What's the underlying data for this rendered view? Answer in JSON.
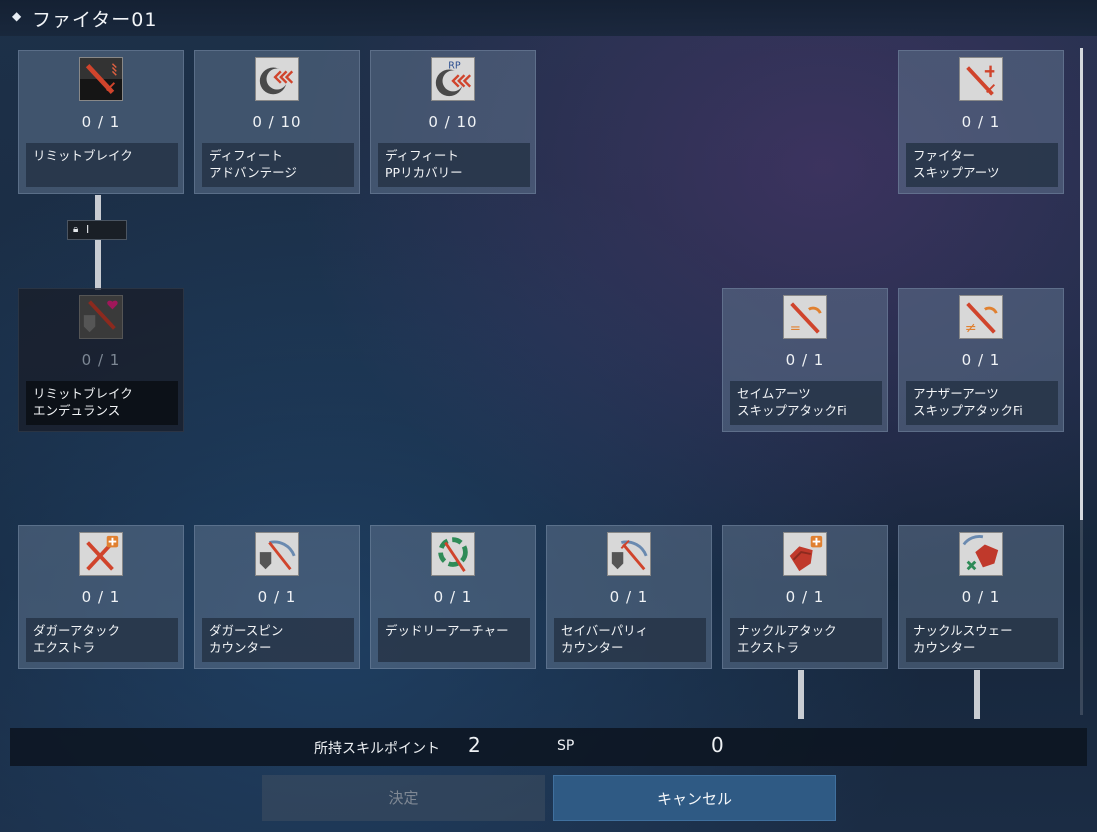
{
  "window": {
    "title": "ファイター01"
  },
  "skills": [
    {
      "id": "limit-break",
      "level": "0 / 1",
      "name": "リミットブレイク",
      "locked": false,
      "icon": "sword-icon"
    },
    {
      "id": "defeat-advantage",
      "level": "0 / 10",
      "name": "ディフィート\nアドバンテージ",
      "locked": false,
      "icon": "defeat-advantage-icon"
    },
    {
      "id": "defeat-pp-recovery",
      "level": "0 / 10",
      "name": "ディフィート\nPPリカバリー",
      "locked": false,
      "icon": "pp-recovery-icon",
      "icon_text": "RP"
    },
    {
      "id": "fighter-skip-arts",
      "level": "0 / 1",
      "name": "ファイター\nスキップアーツ",
      "locked": false,
      "icon": "skip-arts-icon"
    },
    {
      "id": "limit-break-endurance",
      "level": "0 / 1",
      "name": "リミットブレイク\nエンデュランス",
      "locked": true,
      "icon": "shield-sword-heart-icon"
    },
    {
      "id": "same-arts-skip",
      "level": "0 / 1",
      "name": "セイムアーツ\nスキップアタックFi",
      "locked": false,
      "icon": "same-arts-icon",
      "icon_text": "="
    },
    {
      "id": "another-arts-skip",
      "level": "0 / 1",
      "name": "アナザーアーツ\nスキップアタックFi",
      "locked": false,
      "icon": "another-arts-icon",
      "icon_text": "≠"
    },
    {
      "id": "dagger-attack-extra",
      "level": "0 / 1",
      "name": "ダガーアタック\nエクストラ",
      "locked": false,
      "icon": "dagger-extra-icon"
    },
    {
      "id": "dagger-spin-counter",
      "level": "0 / 1",
      "name": "ダガースピン\nカウンター",
      "locked": false,
      "icon": "dagger-counter-icon"
    },
    {
      "id": "deadly-archer",
      "level": "0 / 1",
      "name": "デッドリーアーチャー",
      "locked": false,
      "icon": "deadly-archer-icon"
    },
    {
      "id": "saber-parry-counter",
      "level": "0 / 1",
      "name": "セイバーパリィ\nカウンター",
      "locked": false,
      "icon": "saber-parry-icon"
    },
    {
      "id": "knuckle-attack-extra",
      "level": "0 / 1",
      "name": "ナックルアタック\nエクストラ",
      "locked": false,
      "icon": "knuckle-extra-icon"
    },
    {
      "id": "knuckle-sway-counter",
      "level": "0 / 1",
      "name": "ナックルスウェー\nカウンター",
      "locked": false,
      "icon": "knuckle-sway-icon"
    }
  ],
  "prerequisite": {
    "lock_icon": "lock-icon",
    "level_text": "I"
  },
  "sp": {
    "label": "所持スキルポイント",
    "value": "2",
    "unit": "SP",
    "allocated": "0"
  },
  "buttons": {
    "confirm": "決定",
    "cancel": "キャンセル"
  },
  "colors": {
    "accent": "#2f5a84",
    "icon_red": "#c0392b",
    "heart": "#a0175a"
  }
}
